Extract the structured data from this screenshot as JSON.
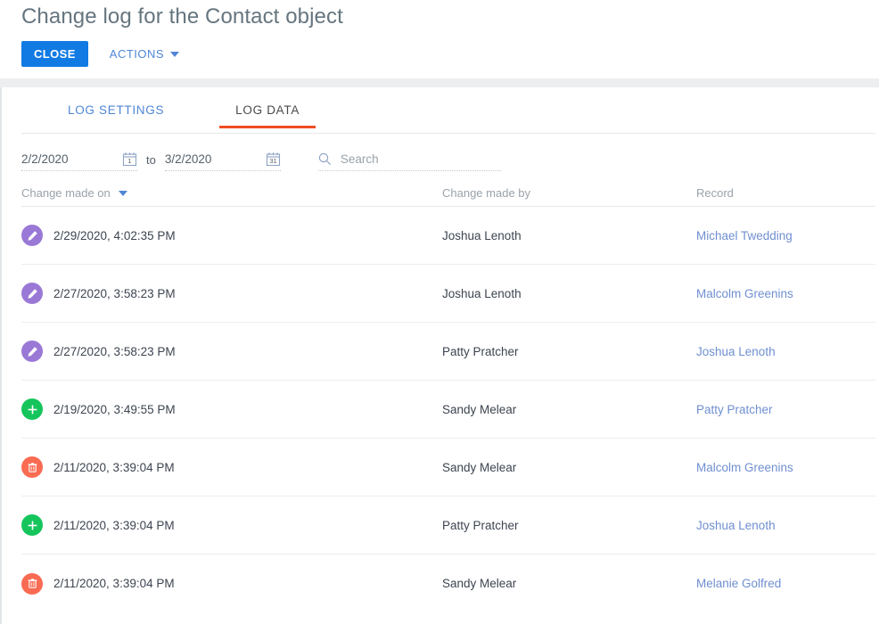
{
  "header": {
    "title": "Change log for the Contact object",
    "close_label": "CLOSE",
    "actions_label": "ACTIONS"
  },
  "tabs": [
    {
      "label": "LOG SETTINGS",
      "active": false
    },
    {
      "label": "LOG DATA",
      "active": true
    }
  ],
  "filters": {
    "date_from": "2/2/2020",
    "date_to": "3/2/2020",
    "to_label": "to",
    "from_icon_day": "1",
    "to_icon_day": "31",
    "search_placeholder": "Search",
    "search_value": ""
  },
  "table": {
    "columns": [
      {
        "key": "date",
        "label": "Change made on",
        "sorted": true,
        "sort_dir": "desc"
      },
      {
        "key": "by",
        "label": "Change made by",
        "sorted": false
      },
      {
        "key": "record",
        "label": "Record",
        "sorted": false
      }
    ],
    "rows": [
      {
        "action": "edit",
        "date": "2/29/2020, 4:02:35 PM",
        "by": "Joshua Lenoth",
        "record": "Michael Twedding"
      },
      {
        "action": "edit",
        "date": "2/27/2020, 3:58:23 PM",
        "by": "Joshua Lenoth",
        "record": "Malcolm Greenins"
      },
      {
        "action": "edit",
        "date": "2/27/2020, 3:58:23 PM",
        "by": "Patty Pratcher",
        "record": "Joshua Lenoth"
      },
      {
        "action": "create",
        "date": "2/19/2020, 3:49:55 PM",
        "by": "Sandy Melear",
        "record": "Patty Pratcher"
      },
      {
        "action": "delete",
        "date": "2/11/2020, 3:39:04 PM",
        "by": "Sandy Melear",
        "record": "Malcolm Greenins"
      },
      {
        "action": "create",
        "date": "2/11/2020, 3:39:04 PM",
        "by": "Patty Pratcher",
        "record": "Joshua Lenoth"
      },
      {
        "action": "delete",
        "date": "2/11/2020, 3:39:04 PM",
        "by": "Sandy Melear",
        "record": "Melanie Golfred"
      }
    ]
  },
  "icons": {
    "edit": "pencil-icon",
    "create": "plus-icon",
    "delete": "trash-icon",
    "calendar": "calendar-icon",
    "search": "search-icon",
    "sort": "chevron-down-icon",
    "dropdown": "caret-down-icon"
  },
  "colors": {
    "primary_button": "#117ae3",
    "link": "#4f86d6",
    "record_link": "#6f8fd0",
    "active_tab_underline": "#f04d23",
    "badge_edit": "#9a78d6",
    "badge_create": "#15c55c",
    "badge_delete": "#f96b52",
    "title": "#65757f",
    "muted_text": "#9aa2aa"
  }
}
